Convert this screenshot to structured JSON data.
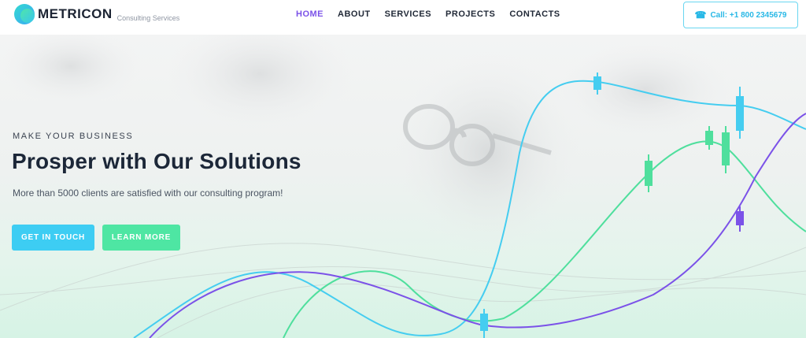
{
  "header": {
    "brand": "METRICON",
    "tagline": "Consulting Services",
    "nav": [
      "HOME",
      "ABOUT",
      "SERVICES",
      "PROJECTS",
      "CONTACTS"
    ],
    "active_nav": "HOME",
    "call_label": "Call: +1 800 2345679",
    "call_icon": "phone-icon"
  },
  "hero": {
    "eyebrow": "MAKE YOUR BUSINESS",
    "title": "Prosper with Our Solutions",
    "subtitle": "More than 5000 clients are satisfied with our consulting program!",
    "primary_button": "GET IN TOUCH",
    "secondary_button": "LEARN MORE"
  },
  "colors": {
    "accent_purple": "#7b52e8",
    "accent_cyan": "#3dcdf3",
    "accent_green": "#4ee6a3",
    "text_dark": "#1c2738"
  }
}
